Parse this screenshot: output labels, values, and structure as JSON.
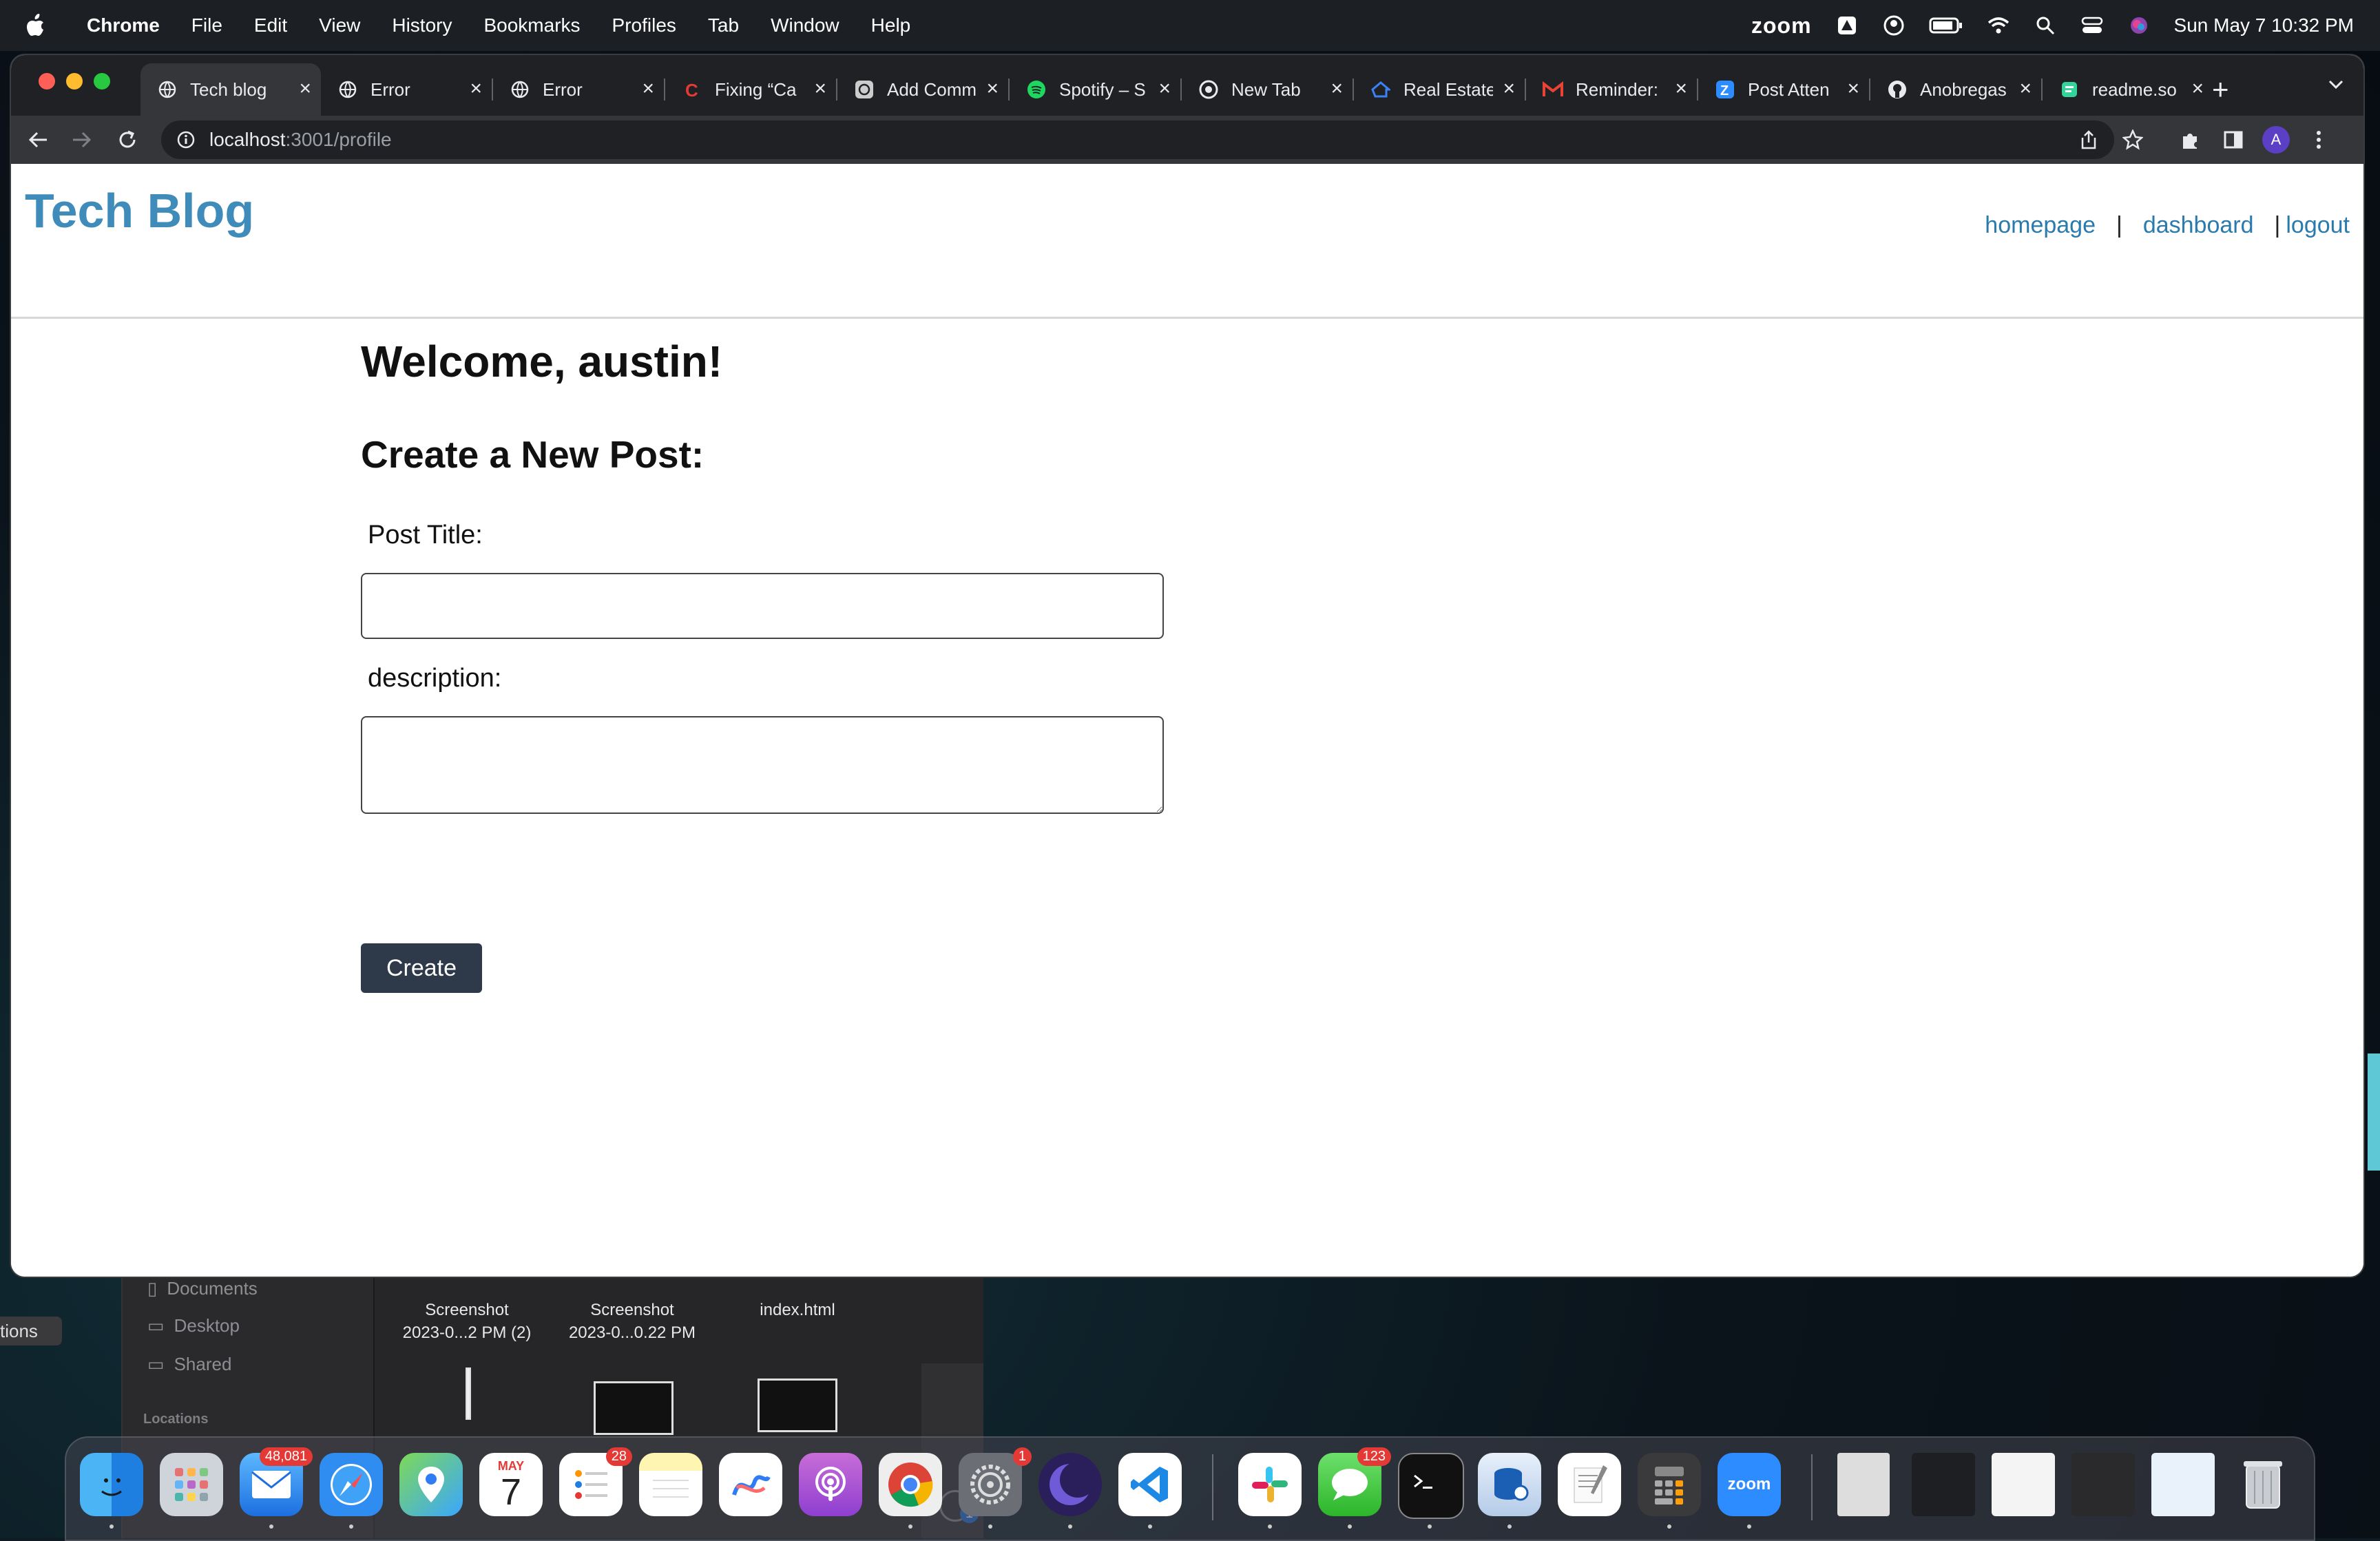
{
  "menubar": {
    "app": "Chrome",
    "items": [
      "File",
      "Edit",
      "View",
      "History",
      "Bookmarks",
      "Profiles",
      "Tab",
      "Window",
      "Help"
    ],
    "zoom_label": "zoom",
    "datetime": "Sun May 7  10:32 PM"
  },
  "tabs": [
    {
      "title": "Tech blog",
      "icon": "globe-icon",
      "active": true
    },
    {
      "title": "Error",
      "icon": "globe-icon"
    },
    {
      "title": "Error",
      "icon": "globe-icon"
    },
    {
      "title": "Fixing “Ca",
      "icon": "c-logo-icon"
    },
    {
      "title": "Add Comm",
      "icon": "chatgpt-icon"
    },
    {
      "title": "Spotify – S",
      "icon": "spotify-icon"
    },
    {
      "title": "New Tab",
      "icon": "chrome-icon"
    },
    {
      "title": "Real Estate",
      "icon": "zillow-icon"
    },
    {
      "title": "Reminder:",
      "icon": "gmail-icon"
    },
    {
      "title": "Post Atten",
      "icon": "zoom-z-icon"
    },
    {
      "title": "Anobregas",
      "icon": "github-icon"
    },
    {
      "title": "readme.so",
      "icon": "readme-icon"
    }
  ],
  "address": {
    "host": "localhost",
    "path": ":3001/profile"
  },
  "site": {
    "title": "Tech Blog",
    "nav": {
      "homepage": "homepage",
      "sep1": "|",
      "dashboard": "dashboard",
      "sep2": "|",
      "logout": "logout"
    }
  },
  "profile": {
    "welcome": "Welcome, austin!",
    "create_heading": "Create a New Post:",
    "title_label": "Post Title:",
    "title_value": "",
    "description_label": "description:",
    "description_value": "",
    "create_button": "Create"
  },
  "finder": {
    "sidebar": [
      "Documents",
      "Desktop",
      "Shared"
    ],
    "locations_header": "Locations",
    "files": [
      {
        "line1": "Screenshot",
        "line2": "2023-0...2 PM (2)"
      },
      {
        "line1": "Screenshot",
        "line2": "2023-0...0.22 PM"
      },
      {
        "line1": "index.html",
        "line2": ""
      }
    ],
    "side_tab": "tions"
  },
  "dock": {
    "mail_badge": "48,081",
    "calendar_month": "MAY",
    "calendar_day": "7",
    "reminders_badge": "28",
    "settings_badge": "1",
    "messages_badge": "123",
    "zoom_label": "zoom",
    "contacts_badge": "1"
  },
  "colors": {
    "brand": "#3f8bb9",
    "nav_link": "#2a7aad",
    "button": "#2e3a4a"
  }
}
